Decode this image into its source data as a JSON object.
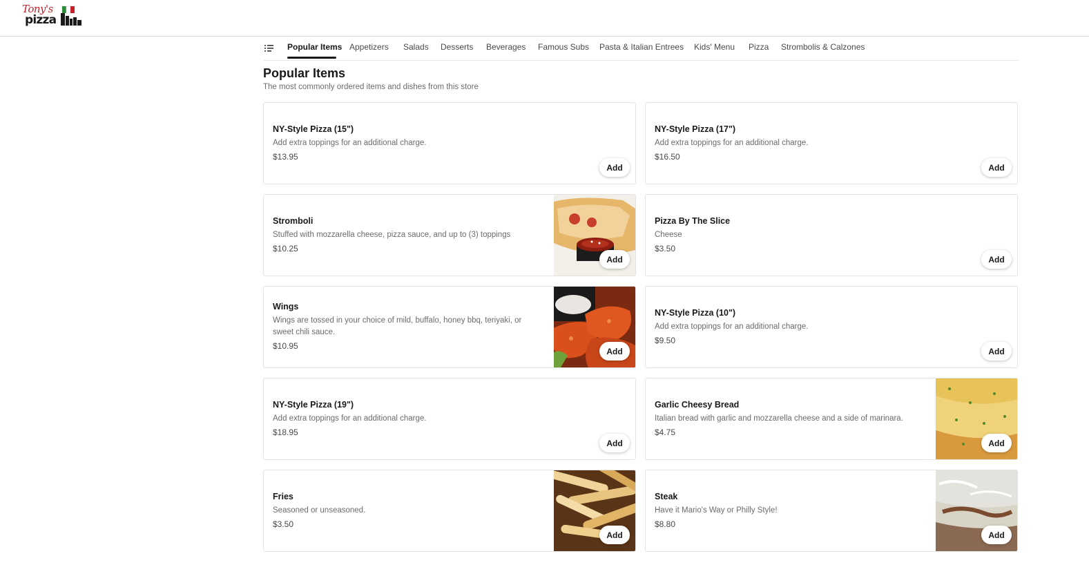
{
  "header": {
    "logo_script": "Tony's",
    "logo_word": "pizza"
  },
  "nav": {
    "tabs": [
      {
        "label": "Popular Items",
        "active": true
      },
      {
        "label": "Appetizers"
      },
      {
        "label": "Salads"
      },
      {
        "label": "Desserts"
      },
      {
        "label": "Beverages"
      },
      {
        "label": "Famous Subs"
      },
      {
        "label": "Pasta & Italian Entrees"
      },
      {
        "label": "Kids' Menu"
      },
      {
        "label": "Pizza"
      },
      {
        "label": "Strombolis & Calzones"
      }
    ]
  },
  "section": {
    "title": "Popular Items",
    "subtitle": "The most commonly ordered items and dishes from this store"
  },
  "items": [
    {
      "name": "NY-Style Pizza (15\")",
      "desc": "Add extra toppings for an additional charge.",
      "price": "$13.95",
      "add": "Add",
      "image": null
    },
    {
      "name": "NY-Style Pizza (17\")",
      "desc": "Add extra toppings for an additional charge.",
      "price": "$16.50",
      "add": "Add",
      "image": null
    },
    {
      "name": "Stromboli",
      "desc": "Stuffed with mozzarella cheese, pizza sauce, and up to (3) toppings",
      "price": "$10.25",
      "add": "Add",
      "image": "stromboli-photo"
    },
    {
      "name": "Pizza By The Slice",
      "desc": "Cheese",
      "price": "$3.50",
      "add": "Add",
      "image": null
    },
    {
      "name": "Wings",
      "desc": "Wings are tossed in your choice of mild, buffalo, honey bbq, teriyaki, or sweet chili sauce.",
      "price": "$10.95",
      "add": "Add",
      "image": "wings-photo"
    },
    {
      "name": "NY-Style Pizza (10\")",
      "desc": "Add extra toppings for an additional charge.",
      "price": "$9.50",
      "add": "Add",
      "image": null
    },
    {
      "name": "NY-Style Pizza (19\")",
      "desc": "Add extra toppings for an additional charge.",
      "price": "$18.95",
      "add": "Add",
      "image": null
    },
    {
      "name": "Garlic Cheesy Bread",
      "desc": "Italian bread with garlic and mozzarella cheese and a side of marinara.",
      "price": "$4.75",
      "add": "Add",
      "image": "garlic-bread-photo"
    },
    {
      "name": "Fries",
      "desc": "Seasoned or unseasoned.",
      "price": "$3.50",
      "add": "Add",
      "image": "fries-photo"
    },
    {
      "name": "Steak",
      "desc": "Have it Mario's Way or Philly Style!",
      "price": "$8.80",
      "add": "Add",
      "image": "steak-photo"
    }
  ]
}
